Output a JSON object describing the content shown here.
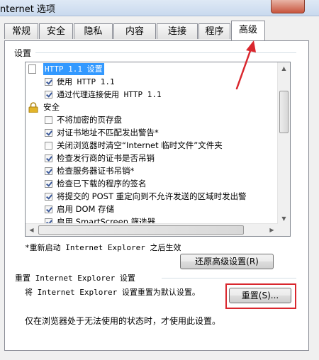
{
  "window": {
    "title": "nternet 选项"
  },
  "tabs": [
    "常规",
    "安全",
    "隐私",
    "内容",
    "连接",
    "程序",
    "高级"
  ],
  "settings": {
    "group_label": "设置",
    "items": [
      {
        "label": "HTTP 1.1 设置",
        "kind": "section",
        "icon": "document-icon",
        "selected": true
      },
      {
        "label": "使用 HTTP 1.1",
        "kind": "check",
        "checked": true
      },
      {
        "label": "通过代理连接使用 HTTP 1.1",
        "kind": "check",
        "checked": true
      },
      {
        "label": "安全",
        "kind": "section",
        "icon": "lock-icon"
      },
      {
        "label": "不将加密的页存盘",
        "kind": "check",
        "checked": false
      },
      {
        "label": "对证书地址不匹配发出警告*",
        "kind": "check",
        "checked": true
      },
      {
        "label": "关闭浏览器时清空“Internet 临时文件”文件夹",
        "kind": "check",
        "checked": false
      },
      {
        "label": "检查发行商的证书是否吊销",
        "kind": "check",
        "checked": true
      },
      {
        "label": "检查服务器证书吊销*",
        "kind": "check",
        "checked": true
      },
      {
        "label": "检查已下载的程序的签名",
        "kind": "check",
        "checked": true
      },
      {
        "label": "将提交的 POST 重定向到不允许发送的区域时发出警",
        "kind": "check",
        "checked": true
      },
      {
        "label": "启用 DOM 存储",
        "kind": "check",
        "checked": true
      },
      {
        "label": "启用 SmartScreen 筛选器",
        "kind": "check",
        "checked": true
      }
    ],
    "restart_note": "*重新启动 Internet Explorer 之后生效",
    "restore_button": "还原高级设置(R)"
  },
  "reset": {
    "group_label": "重置 Internet Explorer 设置",
    "description": "将 Internet Explorer 设置重置为默认设置。",
    "button": "重置(S)...",
    "note": "仅在浏览器处于无法使用的状态时，才使用此设置。"
  },
  "colors": {
    "highlight": "#3399ff",
    "annotation": "#d9272e"
  }
}
